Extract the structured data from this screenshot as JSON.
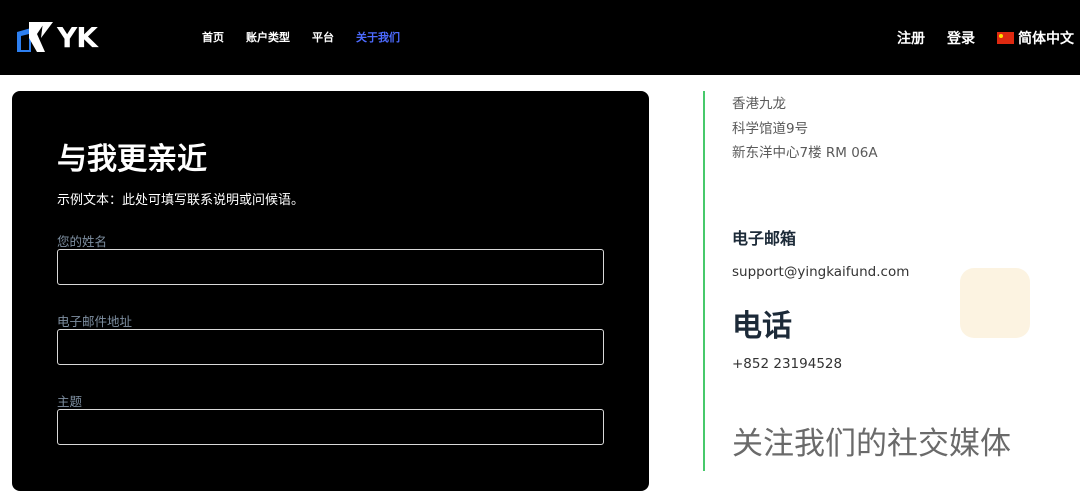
{
  "header": {
    "logo_text": "YK",
    "nav": [
      {
        "label": "首页",
        "active": false
      },
      {
        "label": "账户类型",
        "active": false
      },
      {
        "label": "平台",
        "active": false
      },
      {
        "label": "关于我们",
        "active": true
      }
    ],
    "register_label": "注册",
    "login_label": "登录",
    "language_label": "简体中文",
    "active_color": "#4d6bff"
  },
  "form": {
    "title": "与我更亲近",
    "subtitle": "示例文本：此处可填写联系说明或问候语。",
    "fields": [
      {
        "label": "您的姓名",
        "value": ""
      },
      {
        "label": "电子邮件地址",
        "value": ""
      },
      {
        "label": "主题",
        "value": ""
      }
    ]
  },
  "contact": {
    "address_lines": [
      "香港九龙",
      "科学馆道9号",
      "新东洋中心7楼 RM 06A"
    ],
    "email_heading": "电子邮箱",
    "email": "support@yingkaifund.com",
    "phone_heading": "电话",
    "phone": "+852 23194528",
    "social_heading": "关注我们的社交媒体",
    "divider_color": "#47c96b"
  }
}
